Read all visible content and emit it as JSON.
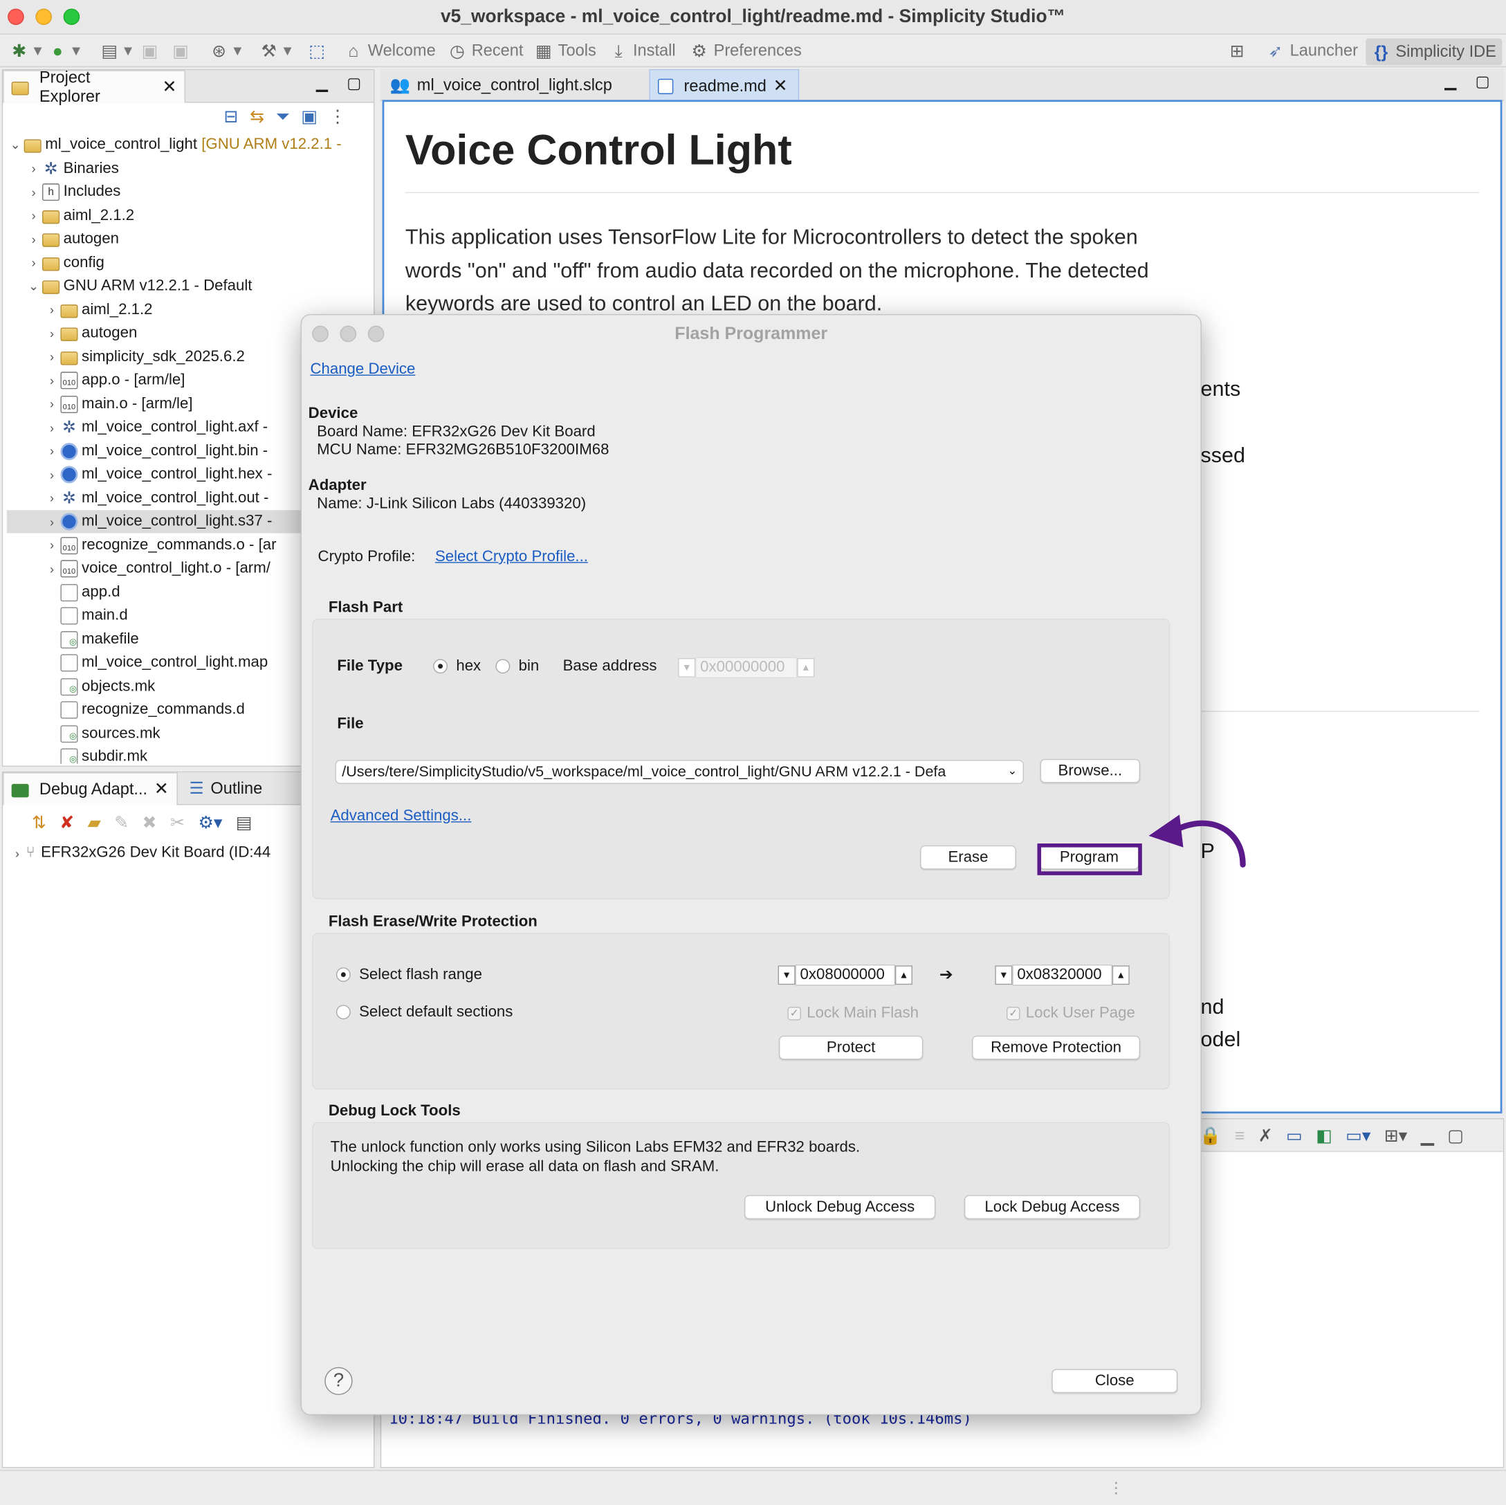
{
  "window": {
    "title": "v5_workspace - ml_voice_control_light/readme.md - Simplicity Studio™"
  },
  "toolbar": {
    "welcome": "Welcome",
    "recent": "Recent",
    "tools": "Tools",
    "install": "Install",
    "preferences": "Preferences",
    "launcher": "Launcher",
    "simplicity_ide": "Simplicity IDE"
  },
  "project_explorer": {
    "tab": "Project Explorer",
    "root": "ml_voice_control_light",
    "root_suffix": "[GNU ARM v12.2.1 -",
    "items": [
      {
        "label": "Binaries"
      },
      {
        "label": "Includes"
      },
      {
        "label": "aiml_2.1.2"
      },
      {
        "label": "autogen"
      },
      {
        "label": "config"
      },
      {
        "label": "GNU ARM v12.2.1 - Default"
      },
      {
        "label": "aiml_2.1.2"
      },
      {
        "label": "autogen"
      },
      {
        "label": "simplicity_sdk_2025.6.2"
      },
      {
        "label": "app.o - [arm/le]"
      },
      {
        "label": "main.o - [arm/le]"
      },
      {
        "label": "ml_voice_control_light.axf -"
      },
      {
        "label": "ml_voice_control_light.bin -"
      },
      {
        "label": "ml_voice_control_light.hex -"
      },
      {
        "label": "ml_voice_control_light.out -"
      },
      {
        "label": "ml_voice_control_light.s37 -"
      },
      {
        "label": "recognize_commands.o - [ar"
      },
      {
        "label": "voice_control_light.o - [arm/"
      },
      {
        "label": "app.d"
      },
      {
        "label": "main.d"
      },
      {
        "label": "makefile"
      },
      {
        "label": "ml_voice_control_light.map"
      },
      {
        "label": "objects.mk"
      },
      {
        "label": "recognize_commands.d"
      },
      {
        "label": "sources.mk"
      },
      {
        "label": "subdir.mk"
      }
    ]
  },
  "debug_panel": {
    "tab1": "Debug Adapt...",
    "tab2": "Outline",
    "device": "EFR32xG26 Dev Kit Board (ID:44"
  },
  "editor": {
    "tab1": "ml_voice_control_light.slcp",
    "tab2": "readme.md",
    "heading": "Voice Control Light",
    "paragraph_line1": "This application uses TensorFlow Lite for Microcontrollers to detect the spoken",
    "paragraph_line2": "words \"on\" and \"off\" from audio data recorded on the microphone. The detected",
    "paragraph_line3": "keywords are used to control an LED on the board.",
    "frag1": "ents",
    "frag2": "ssed",
    "frag3": "P",
    "frag4": "nd",
    "frag5": "odel",
    "console_line": "10:18:47 Build Finished. 0 errors, 0 warnings. (took 10s.146ms)"
  },
  "dialog": {
    "title": "Flash Programmer",
    "change_device": "Change Device",
    "device_heading": "Device",
    "board_name": "Board Name: EFR32xG26 Dev Kit Board",
    "mcu_name": "MCU Name: EFR32MG26B510F3200IM68",
    "adapter_heading": "Adapter",
    "adapter_name": "Name: J-Link Silicon Labs (440339320)",
    "crypto_label": "Crypto Profile:",
    "crypto_link": "Select Crypto Profile...",
    "flash_part": {
      "heading": "Flash Part",
      "file_type_label": "File Type",
      "hex": "hex",
      "bin": "bin",
      "file_type_selected": "hex",
      "base_address_label": "Base address",
      "base_address": "0x00000000",
      "file_label": "File",
      "file_path": "/Users/tere/SimplicityStudio/v5_workspace/ml_voice_control_light/GNU ARM v12.2.1 - Defa",
      "browse": "Browse...",
      "advanced": "Advanced Settings...",
      "erase": "Erase",
      "program": "Program"
    },
    "protection": {
      "heading": "Flash Erase/Write Protection",
      "select_range": "Select flash range",
      "select_default": "Select default sections",
      "range_start": "0x08000000",
      "range_end": "0x08320000",
      "arrow": "➔",
      "lock_main": "Lock Main Flash",
      "lock_user": "Lock User Page",
      "protect": "Protect",
      "remove": "Remove Protection"
    },
    "debug_lock": {
      "heading": "Debug Lock Tools",
      "line1": "The unlock function only works using Silicon Labs EFM32 and EFR32 boards.",
      "line2": "Unlocking the chip will erase all data on flash and SRAM.",
      "unlock": "Unlock Debug Access",
      "lock": "Lock Debug Access"
    },
    "help": "?",
    "close": "Close"
  },
  "annotation": {
    "highlight_color": "#5a1a8a"
  }
}
